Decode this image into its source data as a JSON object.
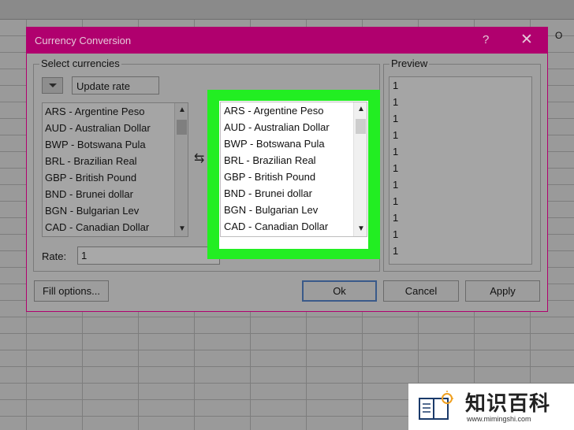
{
  "spreadsheet": {
    "column_letter": "O"
  },
  "dialog": {
    "title": "Currency Conversion",
    "help_glyph": "?",
    "close_glyph": "✕",
    "select_group_label": "Select currencies",
    "update_rate_label": "Update rate",
    "source_currencies": [
      "ARS - Argentine Peso",
      "AUD - Australian Dollar",
      "BWP - Botswana Pula",
      "BRL - Brazilian Real",
      "GBP - British Pound",
      "BND - Brunei dollar",
      "BGN - Bulgarian Lev",
      "CAD - Canadian Dollar"
    ],
    "target_currencies": [
      "ARS - Argentine Peso",
      "AUD - Australian Dollar",
      "BWP - Botswana Pula",
      "BRL - Brazilian Real",
      "GBP - British Pound",
      "BND - Brunei dollar",
      "BGN - Bulgarian Lev",
      "CAD - Canadian Dollar"
    ],
    "rate_label": "Rate:",
    "rate_value": "1",
    "preview_label": "Preview",
    "preview_values": [
      "1",
      "1",
      "1",
      "1",
      "1",
      "1",
      "1",
      "1",
      "1",
      "1",
      "1"
    ],
    "fill_options_label": "Fill options...",
    "ok_label": "Ok",
    "cancel_label": "Cancel",
    "apply_label": "Apply"
  },
  "colors": {
    "titlebar": "#b0006e",
    "highlight": "#22ee22"
  },
  "watermark": {
    "title": "知识百科",
    "url": "www.mimingshi.com"
  }
}
